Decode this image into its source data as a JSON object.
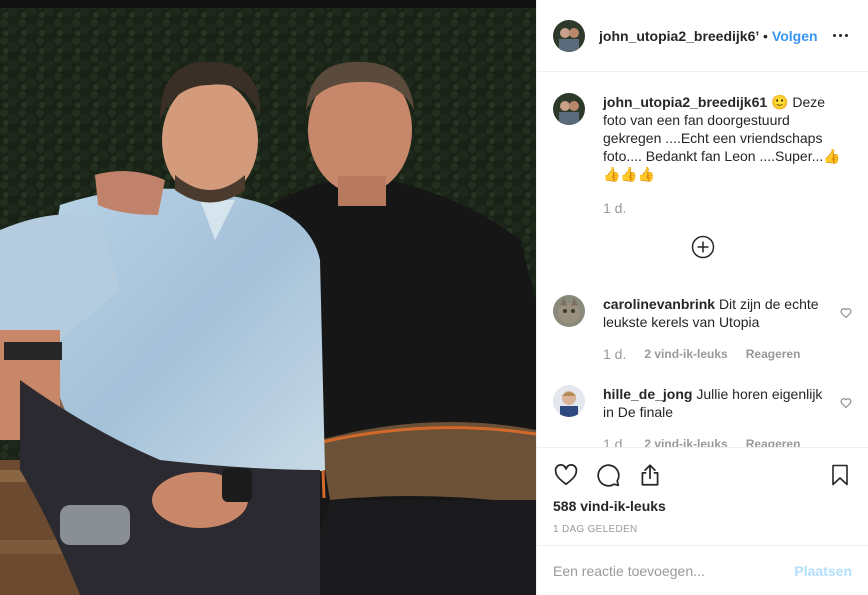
{
  "post": {
    "photo_alt": "",
    "username": "john_utopia2_breedijk61",
    "username_header": "john_utopia2_breedijk6’",
    "dot": "•",
    "follow_label": "Volgen"
  },
  "caption": {
    "username": "john_utopia2_breedijk61",
    "text": "🙂 Deze foto van een fan doorgestuurd gekregen ....Echt een vriendschaps foto.... Bedankt fan Leon ....Super...👍👍👍👍",
    "time": "1 d."
  },
  "comments": [
    {
      "username": "carolinevanbrink",
      "text": "Dit zijn de echte leukste kerels van Utopia",
      "time": "1 d.",
      "likes": "2 vind-ik-leuks",
      "reply": "Reageren"
    },
    {
      "username": "hille_de_jong",
      "text": "Jullie horen eigenlijk in De finale",
      "time": "1 d.",
      "likes": "2 vind-ik-leuks",
      "reply": "Reageren"
    }
  ],
  "stats": {
    "likes": "588 vind-ik-leuks",
    "date": "1 DAG GELEDEN"
  },
  "add_comment": {
    "placeholder": "Een reactie toevoegen...",
    "post_label": "Plaatsen"
  },
  "icons": {
    "like": "heart-icon",
    "comment": "comment-icon",
    "share": "share-icon",
    "save": "bookmark-icon",
    "more": "more-options-icon",
    "load_more": "plus-circle-icon"
  },
  "colors": {
    "link": "#3897f0",
    "muted": "#999999",
    "post_disabled": "#b2dffc",
    "text": "#262626"
  }
}
